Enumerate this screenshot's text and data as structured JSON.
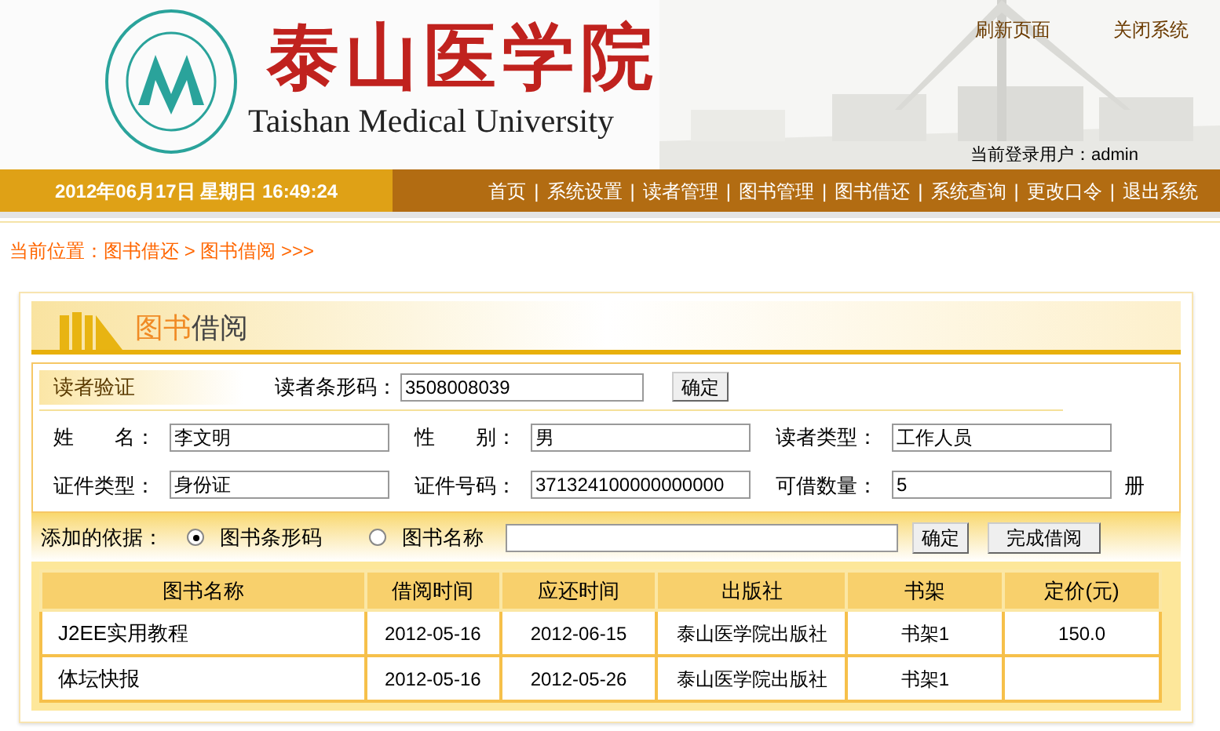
{
  "header": {
    "title": "泰山医学院",
    "subtitle": "Taishan Medical University",
    "links": [
      "刷新页面",
      "关闭系统"
    ],
    "user": "当前登录用户：admin"
  },
  "nav": {
    "datetime": "2012年06月17日 星期日 16:49:24",
    "items": [
      "首页",
      "系统设置",
      "读者管理",
      "图书管理",
      "图书借还",
      "系统查询",
      "更改口令",
      "退出系统"
    ],
    "separator": "|"
  },
  "breadcrumb": "当前位置：图书借还 > 图书借阅 >>>",
  "panel": {
    "title_highlight": "图书",
    "title_rest": "借阅"
  },
  "reader_check": {
    "label": "读者验证",
    "barcode_label": "读者条形码：",
    "barcode_value": "3508008039",
    "button": "确定"
  },
  "fields": [
    {
      "label": "姓　　名：",
      "value": "李文明"
    },
    {
      "label": "性　　别：",
      "value": "男"
    },
    {
      "label": "读者类型：",
      "value": "工作人员"
    },
    {
      "label": "证件类型：",
      "value": "身份证"
    },
    {
      "label": "证件号码：",
      "value": "371324100000000000"
    },
    {
      "label": "可借数量：",
      "value": "5",
      "suffix": "册"
    }
  ],
  "add_by": {
    "label": "添加的依据：",
    "options": [
      {
        "label": "图书条形码",
        "selected": true
      },
      {
        "label": "图书名称",
        "selected": false
      }
    ],
    "buttons": [
      "确定",
      "完成借阅"
    ]
  },
  "table": {
    "columns": [
      "图书名称",
      "借阅时间",
      "应还时间",
      "出版社",
      "书架",
      "定价(元)"
    ],
    "rows": [
      [
        "J2EE实用教程",
        "2012-05-16",
        "2012-06-15",
        "泰山医学院出版社",
        "书架1",
        "150.0"
      ],
      [
        "体坛快报",
        "2012-05-16",
        "2012-05-26",
        "泰山医学院出版社",
        "书架1"
      ]
    ]
  }
}
